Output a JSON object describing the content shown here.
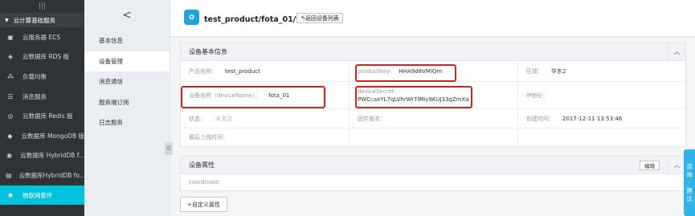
{
  "nav": {
    "top_icon": "menu-icon",
    "section": "云计算基础服务",
    "items": [
      {
        "label": "云服务器 ECS",
        "icon": "ecs-icon"
      },
      {
        "label": "云数据库 RDS 版",
        "icon": "rds-icon"
      },
      {
        "label": "负载均衡",
        "icon": "slb-icon"
      },
      {
        "label": "消息服务",
        "icon": "message-icon"
      },
      {
        "label": "云数据库 Redis 版",
        "icon": "redis-icon"
      },
      {
        "label": "云数据库 MongoDB 版",
        "icon": "mongodb-icon"
      },
      {
        "label": "云数据库 HybridDB f...",
        "icon": "hybriddb-icon"
      },
      {
        "label": "云数据库HybridDB fo...",
        "icon": "hybriddb2-icon"
      },
      {
        "label": "物联网套件",
        "icon": "iot-icon",
        "active": true
      }
    ]
  },
  "submenu": {
    "back": "<",
    "items": [
      "基本信息",
      "设备管理",
      "消息通信",
      "服务端订阅",
      "日志服务"
    ],
    "active_index": 1
  },
  "header": {
    "title": "test_product/fota_01/设备详情",
    "back_label": "返回设备列表"
  },
  "device_info": {
    "heading": "设备基本信息",
    "product_name_label": "产品名称：",
    "product_name": "test_product",
    "product_key_label": "productKey:",
    "product_key": "HHA9d8VMlQm",
    "region_label": "区域：",
    "region": "华东2",
    "device_name_label": "设备名称（deviceName）：",
    "device_name": "fota_01",
    "device_secret_label": "deviceSecret:",
    "device_secret": "PWCcaxYL7qLVhrWrTlMiy9KUJ33qZmXa",
    "ip_label": "IP地址：",
    "status_label": "状态：",
    "status": "未激活",
    "firmware_label": "固件版本：",
    "created_label": "创建时间：",
    "created": "2017-12-11 13:53:46",
    "last_online_label": "最后上线时间："
  },
  "device_props": {
    "heading": "设备属性",
    "edit_label": "编辑",
    "coordinate_label": "coordinate:"
  },
  "add_custom_label": "+自定义属性",
  "feedback": [
    "咨",
    "询",
    "·",
    "建",
    "议"
  ],
  "colors": {
    "nav_bg": "#2f3335",
    "accent": "#00c1de",
    "highlight": "#d9201b"
  }
}
